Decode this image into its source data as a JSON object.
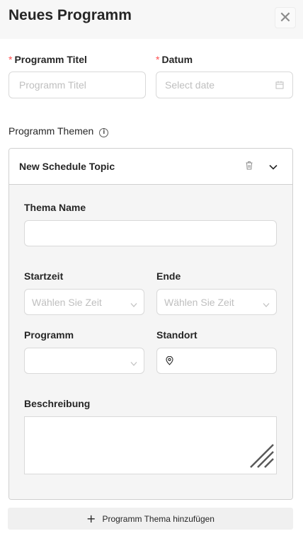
{
  "modal": {
    "title": "Neues Programm",
    "close_icon": "close-icon"
  },
  "form": {
    "program_title": {
      "label": "Programm Titel",
      "placeholder": "Programm Titel"
    },
    "date": {
      "label": "Datum",
      "placeholder": "Select date"
    },
    "topics_label": "Programm Themen",
    "required_color": "#ff4d4f"
  },
  "topic": {
    "title": "New Schedule Topic",
    "name_label": "Thema Name",
    "name_value": "",
    "start_label": "Startzeit",
    "start_placeholder": "Wählen Sie Zeit",
    "end_label": "Ende",
    "end_placeholder": "Wählen Sie Zeit",
    "program_label": "Programm",
    "program_value": "",
    "location_label": "Standort",
    "location_value": "",
    "description_label": "Beschreibung",
    "description_value": ""
  },
  "actions": {
    "add_topic": "Programm Thema hinzufügen"
  }
}
